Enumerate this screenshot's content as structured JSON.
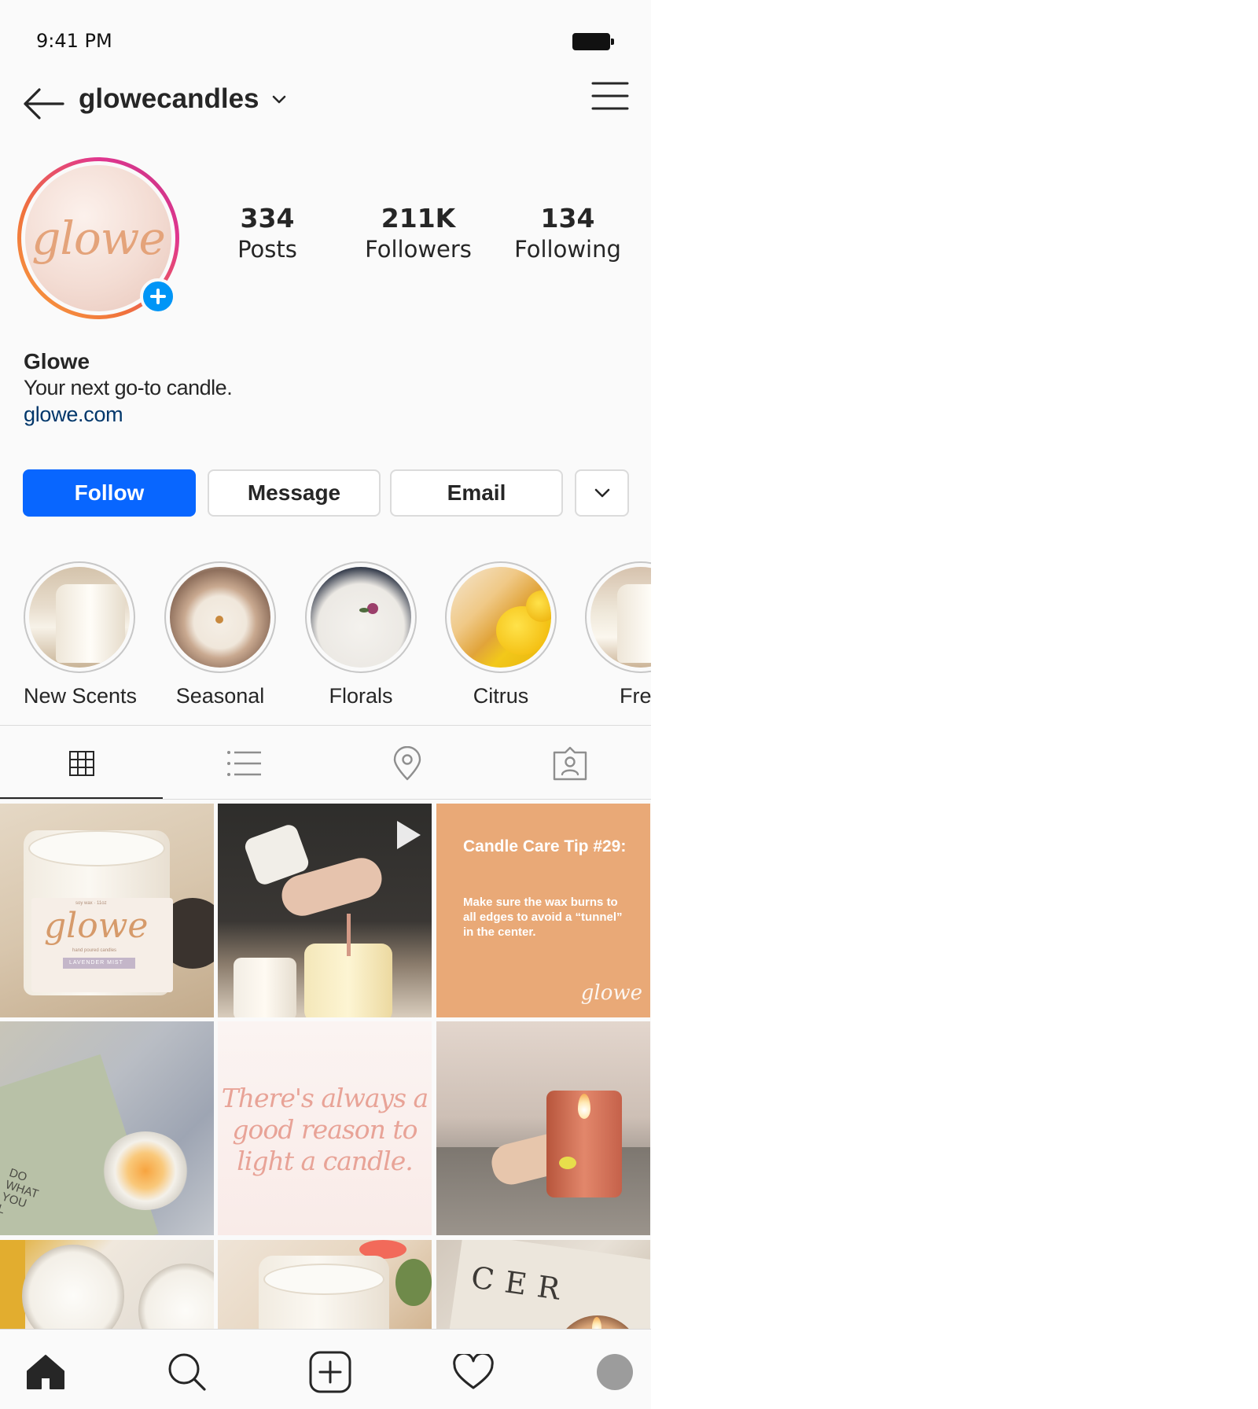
{
  "status_bar": {
    "time": "9:41 PM"
  },
  "header": {
    "username": "glowecandles"
  },
  "profile": {
    "avatar_logo": "glowe",
    "stats": [
      {
        "value": "334",
        "label": "Posts"
      },
      {
        "value": "211K",
        "label": "Followers"
      },
      {
        "value": "134",
        "label": "Following"
      }
    ],
    "name": "Glowe",
    "bio": "Your next go-to candle.",
    "website": "glowe.com"
  },
  "actions": {
    "follow": "Follow",
    "message": "Message",
    "email": "Email"
  },
  "highlights": [
    {
      "label": "New Scents"
    },
    {
      "label": "Seasonal"
    },
    {
      "label": "Florals"
    },
    {
      "label": "Citrus"
    },
    {
      "label": "Fres"
    }
  ],
  "tabs": [
    "grid-icon",
    "list-icon",
    "location-icon",
    "tagged-icon"
  ],
  "posts": {
    "p1_logo": "glowe",
    "p1_small": "soy wax · 11oz",
    "p1_sub": "hand poured candles",
    "p1_scent": "LAVENDER MIST",
    "p3_title": "Candle Care Tip #29:",
    "p3_body": "Make sure the wax burns to all edges to avoid a “tunnel” in the center.",
    "p3_logo": "glowe",
    "p4_book": "DO WHAT YOU L",
    "p5_quote": "There's always a good reason to light a candle.",
    "p9_text": "CER"
  },
  "colors": {
    "accent": "#0866ff",
    "link": "#00376b",
    "tip_bg": "#e9a977",
    "quote": "#e8a397"
  }
}
